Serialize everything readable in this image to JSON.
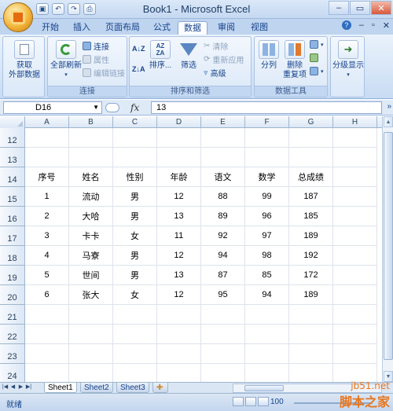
{
  "window": {
    "title": "Book1 - Microsoft Excel",
    "controls": [
      "–",
      "▭",
      "✕"
    ]
  },
  "quick_access": [
    "save-icon",
    "undo-icon",
    "redo-icon",
    "print-preview-icon"
  ],
  "ribbon": {
    "tabs": [
      "开始",
      "插入",
      "页面布局",
      "公式",
      "数据",
      "审阅",
      "视图"
    ],
    "active_tab": "数据",
    "groups": {
      "get_external": {
        "label": "获取\n外部数据",
        "label_l1": "获取",
        "label_l2": "外部数据"
      },
      "connections": {
        "label": "连接",
        "refresh_all": "全部刷新",
        "items": [
          "连接",
          "属性",
          "编辑链接"
        ]
      },
      "sort_filter": {
        "label": "排序和筛选",
        "sort": "排序...",
        "filter": "筛选",
        "items": [
          "清除",
          "重新应用",
          "高级"
        ]
      },
      "data_tools": {
        "label": "数据工具",
        "split": "分列",
        "remove_dup_l1": "删除",
        "remove_dup_l2": "重复项"
      },
      "outline": {
        "label": "分级显示"
      }
    }
  },
  "formula_bar": {
    "name_box": "D16",
    "fx": "fx",
    "value": "13"
  },
  "columns": [
    "A",
    "B",
    "C",
    "D",
    "E",
    "F",
    "G",
    "H"
  ],
  "rows": [
    {
      "num": "12",
      "cells": [
        "",
        "",
        "",
        "",
        "",
        "",
        ""
      ]
    },
    {
      "num": "13",
      "cells": [
        "",
        "",
        "",
        "",
        "",
        "",
        ""
      ]
    },
    {
      "num": "14",
      "cells": [
        "序号",
        "姓名",
        "性别",
        "年龄",
        "语文",
        "数学",
        "总成绩"
      ]
    },
    {
      "num": "15",
      "cells": [
        "1",
        "流动",
        "男",
        "12",
        "88",
        "99",
        "187"
      ]
    },
    {
      "num": "16",
      "cells": [
        "2",
        "大哈",
        "男",
        "13",
        "89",
        "96",
        "185"
      ]
    },
    {
      "num": "17",
      "cells": [
        "3",
        "卡卡",
        "女",
        "11",
        "92",
        "97",
        "189"
      ]
    },
    {
      "num": "18",
      "cells": [
        "4",
        "马寮",
        "男",
        "12",
        "94",
        "98",
        "192"
      ]
    },
    {
      "num": "19",
      "cells": [
        "5",
        "世间",
        "男",
        "13",
        "87",
        "85",
        "172"
      ]
    },
    {
      "num": "20",
      "cells": [
        "6",
        "张大",
        "女",
        "12",
        "95",
        "94",
        "189"
      ]
    },
    {
      "num": "21",
      "cells": [
        "",
        "",
        "",
        "",
        "",
        "",
        ""
      ]
    },
    {
      "num": "22",
      "cells": [
        "",
        "",
        "",
        "",
        "",
        "",
        ""
      ]
    },
    {
      "num": "23",
      "cells": [
        "",
        "",
        "",
        "",
        "",
        "",
        ""
      ]
    },
    {
      "num": "24",
      "cells": [
        "",
        "",
        "",
        "",
        "",
        "",
        ""
      ]
    }
  ],
  "sheets": [
    "Sheet1",
    "Sheet2",
    "Sheet3"
  ],
  "active_sheet": "Sheet1",
  "status": {
    "text": "就绪",
    "zoom": "100"
  },
  "watermark": {
    "url": "jb51.net",
    "name": "脚本之家"
  }
}
